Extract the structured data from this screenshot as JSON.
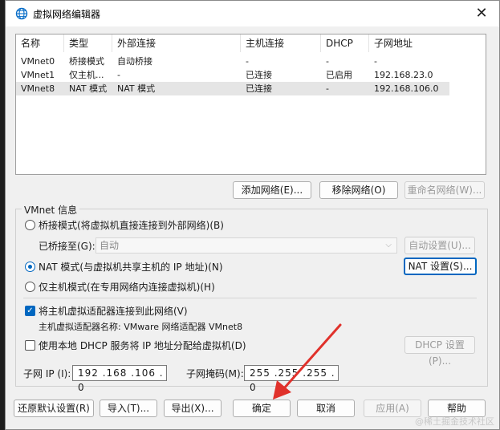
{
  "window": {
    "title": "虚拟网络编辑器"
  },
  "table": {
    "headers": [
      "名称",
      "类型",
      "外部连接",
      "主机连接",
      "DHCP",
      "子网地址"
    ],
    "rows": [
      [
        "VMnet0",
        "桥接模式",
        "自动桥接",
        "-",
        "-",
        "-"
      ],
      [
        "VMnet1",
        "仅主机...",
        "-",
        "已连接",
        "已启用",
        "192.168.23.0"
      ],
      [
        "VMnet8",
        "NAT 模式",
        "NAT 模式",
        "已连接",
        "-",
        "192.168.106.0"
      ]
    ],
    "selected_row": 2
  },
  "list_buttons": {
    "add": "添加网络(E)...",
    "remove": "移除网络(O)",
    "rename": "重命名网络(W)..."
  },
  "vmnet_info": {
    "group_label": "VMnet 信息",
    "bridged_label": "桥接模式(将虚拟机直接连接到外部网络)(B)",
    "bridged_to_label": "已桥接至(G):",
    "bridged_to_value": "自动",
    "auto_settings": "自动设置(U)...",
    "nat_label": "NAT 模式(与虚拟机共享主机的 IP 地址)(N)",
    "nat_settings": "NAT 设置(S)...",
    "hostonly_label": "仅主机模式(在专用网络内连接虚拟机)(H)",
    "connect_adapter_label": "将主机虚拟适配器连接到此网络(V)",
    "adapter_name_label": "主机虚拟适配器名称: VMware 网络适配器 VMnet8",
    "dhcp_label": "使用本地 DHCP 服务将 IP 地址分配给虚拟机(D)",
    "dhcp_settings": "DHCP 设置(P)...",
    "subnet_ip_label": "子网 IP (I):",
    "subnet_ip_value": "192 .168 .106 . 0",
    "subnet_mask_label": "子网掩码(M):",
    "subnet_mask_value": "255 .255 .255 . 0",
    "selected_mode": "nat",
    "connect_adapter_checked": true,
    "dhcp_checked": false
  },
  "footer_buttons": {
    "restore": "还原默认设置(R)",
    "import": "导入(T)...",
    "export": "导出(X)...",
    "ok": "确定",
    "cancel": "取消",
    "apply": "应用(A)",
    "help": "帮助"
  },
  "watermark": "@稀土掘金技术社区",
  "colors": {
    "accent": "#0067c0",
    "arrow": "#e0312b"
  }
}
